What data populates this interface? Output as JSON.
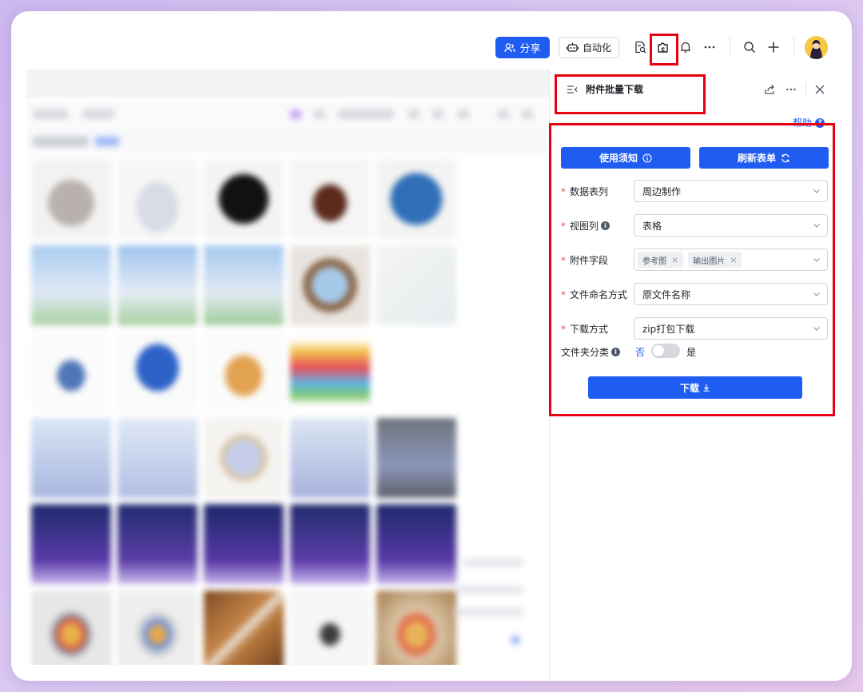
{
  "toolbar": {
    "share_label": "分享",
    "automation_label": "自动化",
    "icons": [
      "doc-search-icon",
      "plugin-icon",
      "bell-icon",
      "more-icon",
      "search-icon",
      "plus-icon"
    ]
  },
  "panel": {
    "title": "附件批量下载",
    "help_label": "帮助",
    "notice_button": "使用须知",
    "refresh_button": "刷新表单",
    "fields": [
      {
        "label": "数据表列",
        "required": true,
        "has_info": false,
        "value": "周边制作"
      },
      {
        "label": "视图列",
        "required": true,
        "has_info": true,
        "value": "表格"
      },
      {
        "label": "附件字段",
        "required": true,
        "has_info": false,
        "tags": [
          "参考图",
          "输出图片"
        ]
      },
      {
        "label": "文件命名方式",
        "required": true,
        "has_info": false,
        "value": "原文件名称"
      },
      {
        "label": "下载方式",
        "required": true,
        "has_info": false,
        "value": "zip打包下载"
      }
    ],
    "folder_toggle": {
      "label": "文件夹分类",
      "off_label": "否",
      "on_label": "是",
      "value": false
    },
    "download_button": "下载"
  },
  "colors": {
    "accent": "#1f5df2",
    "highlight": "#e60012",
    "required": "#f54a45"
  }
}
